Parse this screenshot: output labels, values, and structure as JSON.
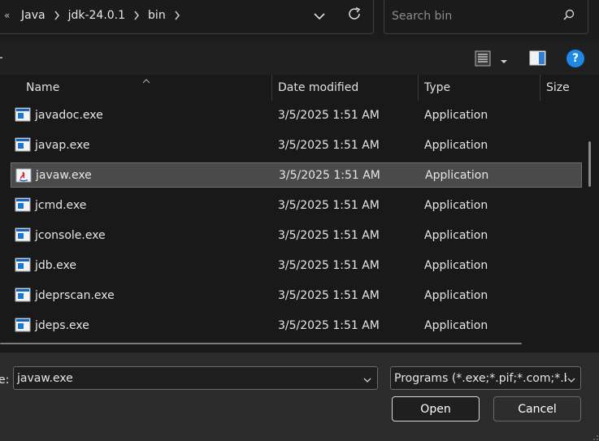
{
  "address_bar": {
    "overflow_glyph": "«",
    "crumbs": [
      "Java",
      "jdk-24.0.1",
      "bin"
    ]
  },
  "search": {
    "placeholder": "Search bin"
  },
  "list": {
    "columns": {
      "name": "Name",
      "date": "Date modified",
      "type": "Type",
      "size": "Size"
    },
    "rows": [
      {
        "name": "javadoc.exe",
        "date": "3/5/2025 1:51 AM",
        "type": "Application",
        "icon": "exe-icon"
      },
      {
        "name": "javap.exe",
        "date": "3/5/2025 1:51 AM",
        "type": "Application",
        "icon": "exe-icon"
      },
      {
        "name": "javaw.exe",
        "date": "3/5/2025 1:51 AM",
        "type": "Application",
        "icon": "java-icon",
        "selected": true
      },
      {
        "name": "jcmd.exe",
        "date": "3/5/2025 1:51 AM",
        "type": "Application",
        "icon": "exe-icon"
      },
      {
        "name": "jconsole.exe",
        "date": "3/5/2025 1:51 AM",
        "type": "Application",
        "icon": "exe-icon"
      },
      {
        "name": "jdb.exe",
        "date": "3/5/2025 1:51 AM",
        "type": "Application",
        "icon": "exe-icon"
      },
      {
        "name": "jdeprscan.exe",
        "date": "3/5/2025 1:51 AM",
        "type": "Application",
        "icon": "exe-icon"
      },
      {
        "name": "jdeps.exe",
        "date": "3/5/2025 1:51 AM",
        "type": "Application",
        "icon": "exe-icon"
      }
    ]
  },
  "footer": {
    "filename_label": "e:",
    "filename_value": "javaw.exe",
    "filter_value": "Programs (*.exe;*.pif;*.com;*.bat",
    "open_label": "Open",
    "cancel_label": "Cancel"
  },
  "colors": {
    "background": "#1c1c1c",
    "selection": "#4a4a4a",
    "help_accent": "#1e88e5",
    "exe_icon_blue": "#1565c0"
  }
}
